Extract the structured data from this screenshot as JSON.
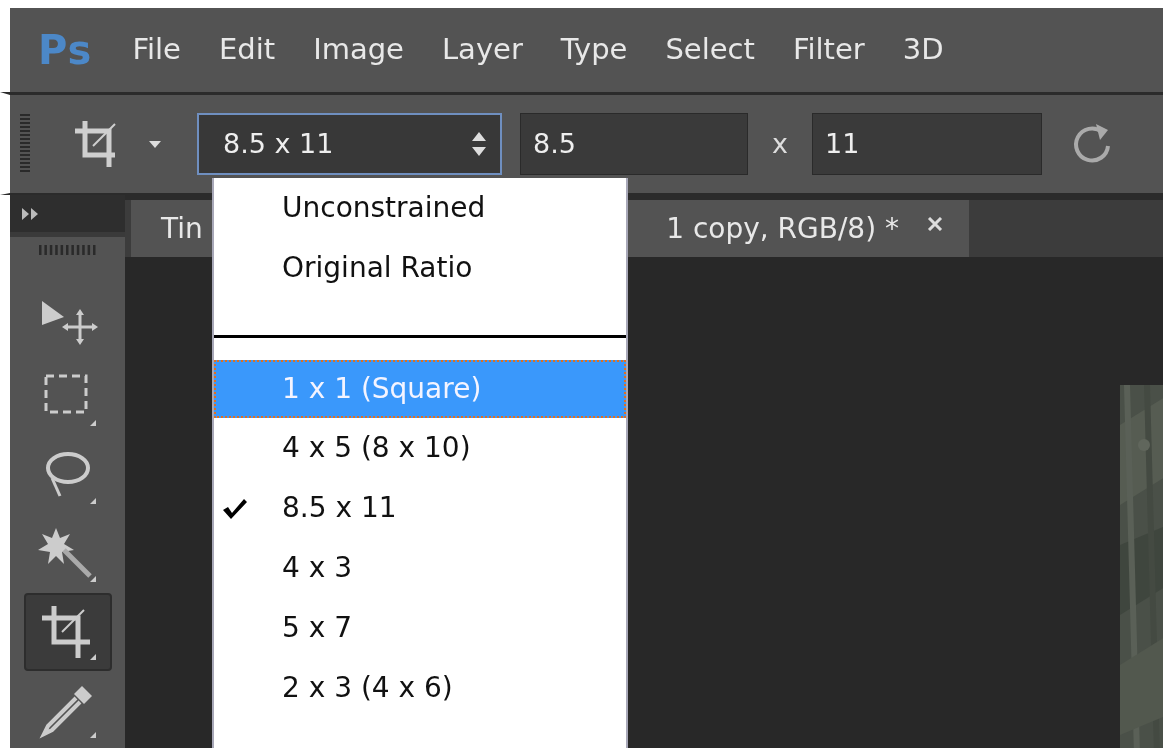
{
  "app": {
    "logo": "Ps"
  },
  "menu_bar": [
    {
      "label": "File"
    },
    {
      "label": "Edit"
    },
    {
      "label": "Image"
    },
    {
      "label": "Layer"
    },
    {
      "label": "Type"
    },
    {
      "label": "Select"
    },
    {
      "label": "Filter"
    },
    {
      "label": "3D"
    }
  ],
  "options_bar": {
    "preset": {
      "value": "8.5 x 11",
      "open": true
    },
    "width": {
      "value": "8.5"
    },
    "times": "x",
    "height": {
      "value": "11"
    }
  },
  "tools": [
    {
      "kind": "move",
      "selected": false
    },
    {
      "kind": "marquee",
      "selected": false
    },
    {
      "kind": "lasso",
      "selected": false
    },
    {
      "kind": "wand",
      "selected": false
    },
    {
      "kind": "crop",
      "selected": true
    },
    {
      "kind": "eyedropper",
      "selected": false
    }
  ],
  "document_tab": {
    "title_start": "Tin",
    "title_end": "1 copy, RGB/8) *"
  },
  "ratio_menu": {
    "items": [
      {
        "kind": "option",
        "label": "Unconstrained",
        "checked": false,
        "highlighted": false
      },
      {
        "kind": "option",
        "label": "Original Ratio",
        "checked": false,
        "highlighted": false
      },
      {
        "kind": "separator"
      },
      {
        "kind": "option",
        "label": "1 x 1 (Square)",
        "checked": false,
        "highlighted": true
      },
      {
        "kind": "option",
        "label": "4 x 5 (8 x 10)",
        "checked": false,
        "highlighted": false
      },
      {
        "kind": "option",
        "label": "8.5 x 11",
        "checked": true,
        "highlighted": false
      },
      {
        "kind": "option",
        "label": "4 x 3",
        "checked": false,
        "highlighted": false
      },
      {
        "kind": "option",
        "label": "5 x 7",
        "checked": false,
        "highlighted": false
      },
      {
        "kind": "option",
        "label": "2 x 3 (4 x 6)",
        "checked": false,
        "highlighted": false
      }
    ]
  }
}
